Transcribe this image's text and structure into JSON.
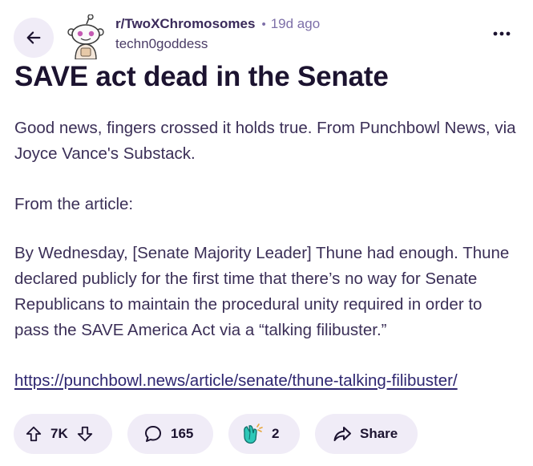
{
  "post": {
    "subreddit": "r/TwoXChromosomes",
    "separator": "•",
    "time_ago": "19d ago",
    "author": "techn0goddess",
    "title": "SAVE act dead in the Senate",
    "body": {
      "p1": "Good news, fingers crossed it holds true. From Punchbowl News, via Joyce Vance's Substack.",
      "p2": "From the article:",
      "p3": "By Wednesday, [Senate Majority Leader] Thune had enough. Thune declared publicly for the first time that there’s no way for Senate Republicans to maintain the procedural unity required in order to pass the SAVE America Act via a “talking filibuster.”",
      "link": "https://punchbowl.news/article/senate/thune-talking-filibuster/"
    }
  },
  "actions": {
    "vote_count": "7K",
    "comment_count": "165",
    "award_count": "2",
    "share_label": "Share"
  },
  "icons": {
    "back": "arrow-left-icon",
    "more": "more-horizontal-icon",
    "upvote": "arrow-up-icon",
    "downvote": "arrow-down-icon",
    "comment": "speech-bubble-icon",
    "award": "clapping-hands-icon",
    "share": "share-arrow-icon"
  },
  "colors": {
    "pill_bg": "#f0ecf7",
    "text_primary": "#1c1330",
    "meta": "#7d6fa8"
  }
}
